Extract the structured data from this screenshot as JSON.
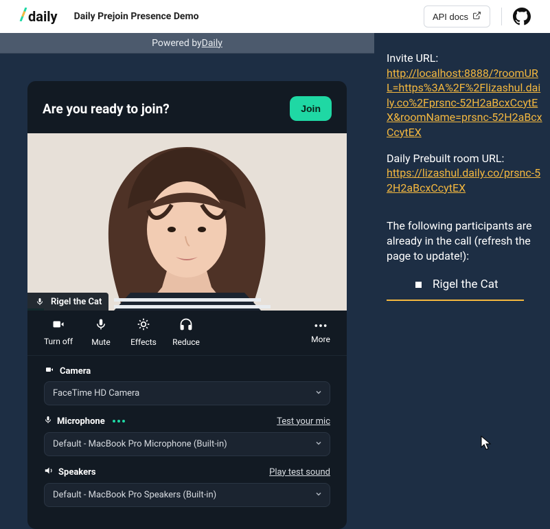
{
  "nav": {
    "logo_text": "daily",
    "demo_title": "Daily Prejoin Presence Demo",
    "api_docs_label": "API docs"
  },
  "powered": {
    "prefix": "Powered by ",
    "link_text": "Daily"
  },
  "prejoin": {
    "heading": "Are you ready to join?",
    "join_label": "Join",
    "participant_name": "Rigel the Cat",
    "controls": {
      "camera": "Turn off",
      "mic": "Mute",
      "effects": "Effects",
      "audio": "Reduce",
      "more": "More"
    },
    "devices": {
      "camera": {
        "label": "Camera",
        "selected": "FaceTime HD Camera"
      },
      "microphone": {
        "label": "Microphone",
        "test_label": "Test your mic",
        "selected": "Default - MacBook Pro Microphone (Built-in)"
      },
      "speakers": {
        "label": "Speakers",
        "test_label": "Play test sound",
        "selected": "Default - MacBook Pro Speakers (Built-in)"
      }
    }
  },
  "side": {
    "invite_label": "Invite URL:",
    "invite_url": "http://localhost:8888/?roomURL=https%3A%2F%2Flizashul.daily.co%2Fprsnc-52H2aBcxCcytEX&roomName=prsnc-52H2aBcxCcytEX",
    "prebuilt_label": "Daily Prebuilt room URL:",
    "prebuilt_url": "https://lizashul.daily.co/prsnc-52H2aBcxCcytEX",
    "participants_label": "The following participants are already in the call (refresh the page to update!):",
    "participants": [
      "Rigel the Cat"
    ]
  }
}
